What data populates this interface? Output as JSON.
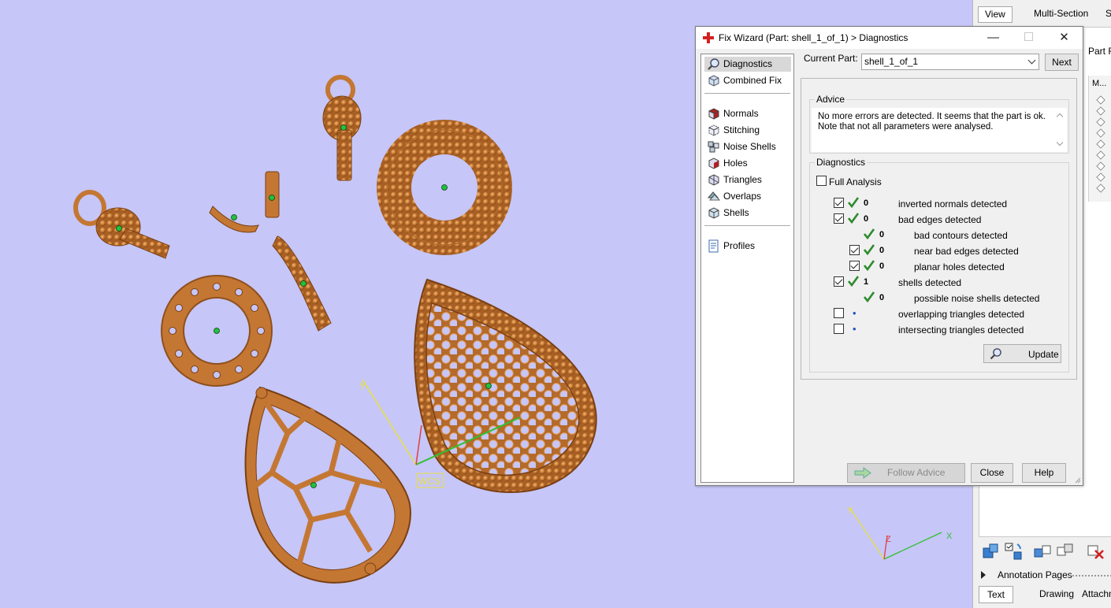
{
  "dialog": {
    "title": "Fix Wizard (Part: shell_1_of_1) > Diagnostics",
    "current_part_label": "Current Part:",
    "current_part_value": "shell_1_of_1",
    "next_label": "Next",
    "nav": {
      "top": [
        "Diagnostics",
        "Combined Fix"
      ],
      "middle": [
        "Normals",
        "Stitching",
        "Noise Shells",
        "Holes",
        "Triangles",
        "Overlaps",
        "Shells"
      ],
      "bottom": [
        "Profiles"
      ]
    },
    "advice": {
      "title": "Advice",
      "line1": "No more errors are detected. It seems that the part is ok.",
      "line2": "Note that not all parameters were analysed."
    },
    "diagnostics": {
      "title": "Diagnostics",
      "full_analysis_label": "Full Analysis",
      "rows": [
        {
          "count": "0",
          "label": "inverted normals detected"
        },
        {
          "count": "0",
          "label": "bad edges detected"
        },
        {
          "count": "0",
          "label": "bad contours detected"
        },
        {
          "count": "0",
          "label": "near bad edges detected"
        },
        {
          "count": "0",
          "label": "planar holes detected"
        },
        {
          "count": "1",
          "label": "shells detected"
        },
        {
          "count": "0",
          "label": "possible noise shells detected"
        },
        {
          "count": "",
          "label": "overlapping triangles detected"
        },
        {
          "count": "",
          "label": "intersecting triangles detected"
        }
      ],
      "update_label": "Update"
    },
    "buttons": {
      "follow_advice": "Follow Advice",
      "close": "Close",
      "help": "Help"
    }
  },
  "side_panel": {
    "tabs": [
      "View",
      "Multi-Section",
      "S"
    ],
    "part_label": "Part F",
    "column_header": "M...",
    "annotation_pages": "Annotation Pages",
    "bottom_tabs": [
      "Text",
      "Drawing",
      "Attachm"
    ]
  },
  "viewport": {
    "wcs_label": "WCS",
    "axis_z": "Z",
    "axis_x": "X",
    "axis_y": "Y"
  },
  "colors": {
    "viewport_bg": "#c6c6f8",
    "gold": "#c77a35",
    "check_green": "#2e8b2e"
  }
}
